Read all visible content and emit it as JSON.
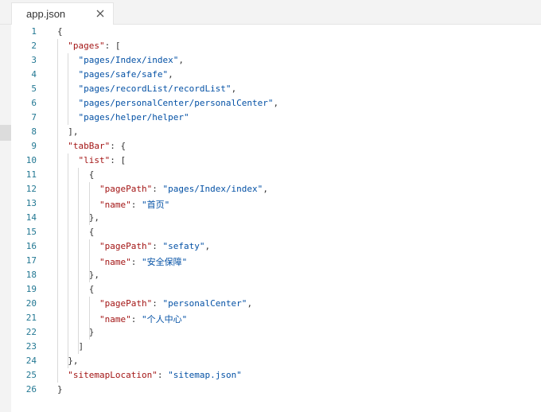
{
  "tab": {
    "title": "app.json",
    "close_icon": "close-icon"
  },
  "code_lines": [
    {
      "no": "1",
      "text": "{"
    },
    {
      "no": "2",
      "text": "  \"pages\": ["
    },
    {
      "no": "3",
      "text": "    \"pages/Index/index\","
    },
    {
      "no": "4",
      "text": "    \"pages/safe/safe\","
    },
    {
      "no": "5",
      "text": "    \"pages/recordList/recordList\","
    },
    {
      "no": "6",
      "text": "    \"pages/personalCenter/personalCenter\","
    },
    {
      "no": "7",
      "text": "    \"pages/helper/helper\""
    },
    {
      "no": "8",
      "text": "  ],"
    },
    {
      "no": "9",
      "text": "  \"tabBar\": {"
    },
    {
      "no": "10",
      "text": "    \"list\": ["
    },
    {
      "no": "11",
      "text": "      {"
    },
    {
      "no": "12",
      "text": "        \"pagePath\": \"pages/Index/index\","
    },
    {
      "no": "13",
      "text": "        \"name\": \"首页\""
    },
    {
      "no": "14",
      "text": "      },"
    },
    {
      "no": "15",
      "text": "      {"
    },
    {
      "no": "16",
      "text": "        \"pagePath\": \"sefaty\","
    },
    {
      "no": "17",
      "text": "        \"name\": \"安全保障\""
    },
    {
      "no": "18",
      "text": "      },"
    },
    {
      "no": "19",
      "text": "      {"
    },
    {
      "no": "20",
      "text": "        \"pagePath\": \"personalCenter\","
    },
    {
      "no": "21",
      "text": "        \"name\": \"个人中心\""
    },
    {
      "no": "22",
      "text": "      }"
    },
    {
      "no": "23",
      "text": "    ]"
    },
    {
      "no": "24",
      "text": "  },"
    },
    {
      "no": "25",
      "text": "  \"sitemapLocation\": \"sitemap.json\""
    },
    {
      "no": "26",
      "text": "}"
    }
  ],
  "colors": {
    "line_number": "#237893",
    "json_key": "#a31515",
    "json_string": "#0451a5",
    "punctuation": "#333333",
    "tab_bar_bg": "#f3f3f3"
  }
}
